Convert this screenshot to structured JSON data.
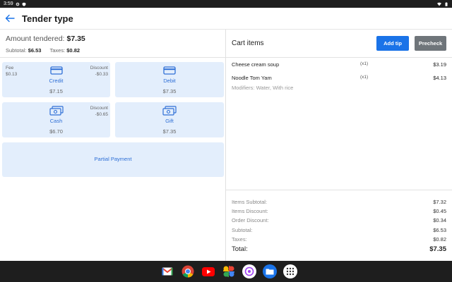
{
  "status_bar": {
    "time": "3:59"
  },
  "app_bar": {
    "title": "Tender type"
  },
  "tender": {
    "amount_label": "Amount tendered:",
    "amount_value": "$7.35",
    "subtotal_label": "Subtotal:",
    "subtotal_value": "$6.53",
    "taxes_label": "Taxes:",
    "taxes_value": "$0.82"
  },
  "tiles": {
    "credit": {
      "label": "Credit",
      "amount": "$7.15",
      "fee_label": "Fee",
      "fee_value": "$0.13",
      "discount_label": "Discount",
      "discount_value": "-$0.33",
      "icon": "credit-card-icon"
    },
    "debit": {
      "label": "Debit",
      "amount": "$7.35",
      "icon": "credit-card-icon"
    },
    "cash": {
      "label": "Cash",
      "amount": "$6.70",
      "discount_label": "Discount",
      "discount_value": "-$0.65",
      "icon": "cash-icon"
    },
    "gift": {
      "label": "Gift",
      "amount": "$7.35",
      "icon": "gift-card-icon"
    },
    "partial": {
      "label": "Partial Payment"
    }
  },
  "cart": {
    "title": "Cart items",
    "add_tip_label": "Add tip",
    "precheck_label": "Precheck",
    "items": [
      {
        "name": "Cheese cream soup",
        "qty": "(x1)",
        "price": "$3.19"
      },
      {
        "name": "Noodle Tom Yam",
        "qty": "(x1)",
        "price": "$4.13",
        "modifiers": "Modifiers: Water, With rice"
      }
    ]
  },
  "summary": {
    "items_subtotal_label": "Items Subtotal:",
    "items_subtotal_value": "$7.32",
    "items_discount_label": "Items Discount:",
    "items_discount_value": "$0.45",
    "order_discount_label": "Order Discount:",
    "order_discount_value": "$0.34",
    "subtotal_label": "Subtotal:",
    "subtotal_value": "$6.53",
    "taxes_label": "Taxes:",
    "taxes_value": "$0.82",
    "total_label": "Total:",
    "total_value": "$7.35"
  },
  "taskbar": {
    "apps": [
      "gmail-icon",
      "chrome-icon",
      "youtube-icon",
      "photos-icon",
      "podcasts-icon",
      "files-icon",
      "app-launcher-icon"
    ]
  },
  "colors": {
    "accent": "#1a73e8",
    "tile_bg": "#e3eefc",
    "tile_text": "#2e6fd6",
    "secondary_button": "#6f757a",
    "system_bar": "#1e1e1e"
  }
}
